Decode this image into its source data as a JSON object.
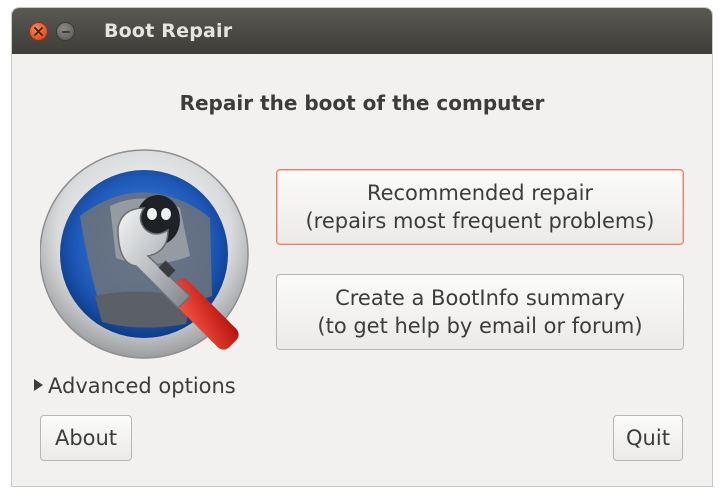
{
  "window": {
    "title": "Boot Repair"
  },
  "main": {
    "heading": "Repair the boot of the computer",
    "recommended": {
      "line1": "Recommended repair",
      "line2": "(repairs most frequent problems)"
    },
    "bootinfo": {
      "line1": "Create a BootInfo summary",
      "line2": "(to get help by email or forum)"
    },
    "advanced_label": "Advanced options"
  },
  "footer": {
    "about_label": "About",
    "quit_label": "Quit"
  },
  "colors": {
    "titlebar": "#3e3d39",
    "window_bg": "#f2f1f0",
    "close_button": "#e05a2e",
    "focus_border": "#e8836a"
  },
  "icons": [
    "close-icon",
    "minimize-icon",
    "boot-repair-logo-icon",
    "expander-triangle-icon"
  ]
}
